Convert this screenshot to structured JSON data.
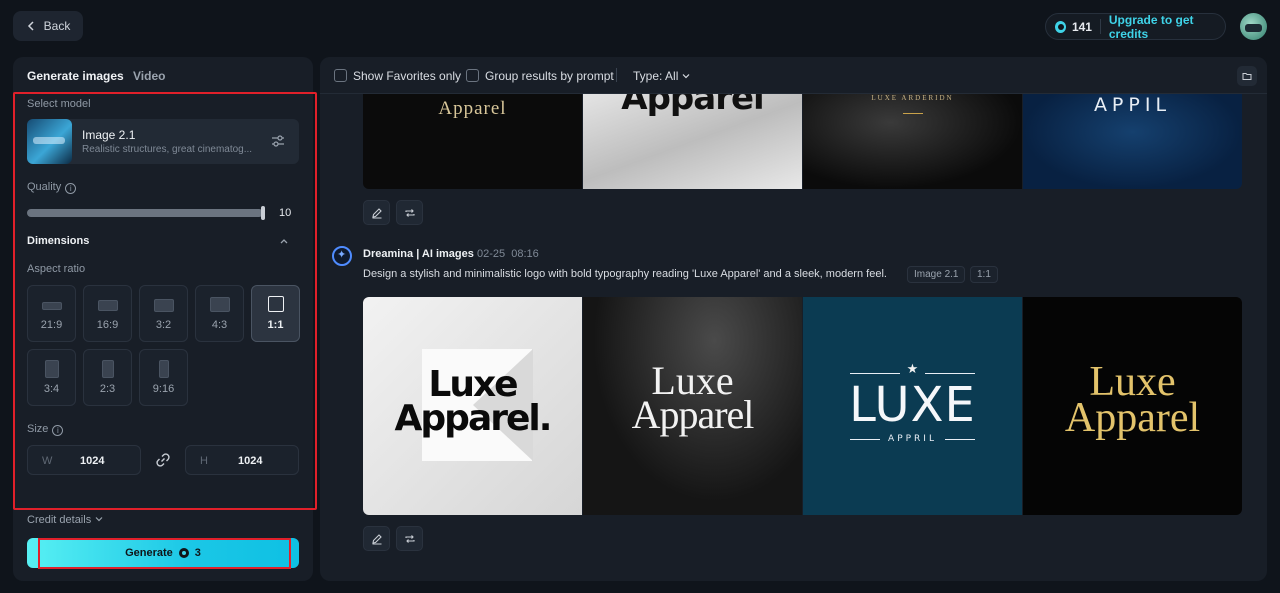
{
  "topbar": {
    "back_label": "Back",
    "credits": "141",
    "upgrade_label": "Upgrade to get credits"
  },
  "left": {
    "tabs": [
      "Generate images",
      "Video"
    ],
    "select_model_label": "Select model",
    "model": {
      "name": "Image 2.1",
      "description": "Realistic structures, great cinematog..."
    },
    "quality_label": "Quality",
    "quality_value": "10",
    "dimensions_label": "Dimensions",
    "aspect_ratio_label": "Aspect ratio",
    "aspect_ratios": [
      "21:9",
      "16:9",
      "3:2",
      "4:3",
      "1:1",
      "3:4",
      "2:3",
      "9:16"
    ],
    "selected_ratio": "1:1",
    "size_label": "Size",
    "width_prefix": "W",
    "width": "1024",
    "height_prefix": "H",
    "height": "1024",
    "credit_details_label": "Credit details",
    "generate_label": "Generate",
    "generate_cost": "3"
  },
  "right": {
    "filters": {
      "favorites_label": "Show Favorites only",
      "group_label": "Group results by prompt",
      "type_label": "Type: All"
    },
    "top_row": [
      {
        "text": "Apparel"
      },
      {
        "text": "Apparel"
      },
      {
        "text": "LUXE ARDERIDN"
      },
      {
        "text": "APPIL"
      }
    ],
    "prompt": {
      "source": "Dreamina | AI images",
      "date": "02-25",
      "time": "08:16",
      "text": "Design a stylish and minimalistic logo with bold typography reading 'Luxe Apparel' and a sleek, modern feel.",
      "model_tag": "Image 2.1",
      "ratio_tag": "1:1"
    },
    "results": [
      {
        "line1": "Luxe",
        "line2": "Apparel."
      },
      {
        "line1": "Luxe",
        "line2": "Apparel"
      },
      {
        "line1": "LUXE",
        "line2": "APPRIL"
      },
      {
        "line1": "Luxe",
        "line2": "Apparel"
      }
    ]
  }
}
